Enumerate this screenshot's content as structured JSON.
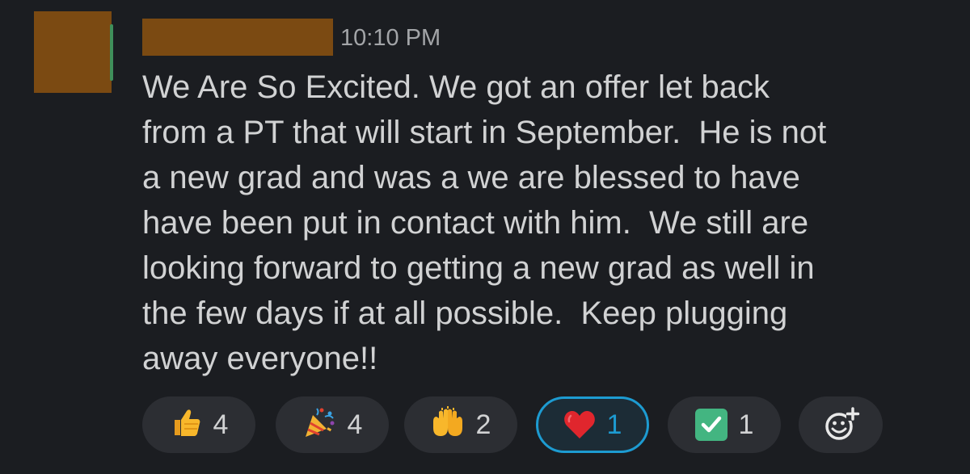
{
  "message": {
    "timestamp": "10:10 PM",
    "lines": [
      "We Are So Excited. We got an offer let back",
      "from a PT that will start in September.  He is not",
      "a new grad and was a we are blessed to have",
      "have been put in contact with him.  We still are",
      "looking forward to getting a new grad as well in",
      "the few days if at all possible.  Keep plugging",
      "away everyone!!"
    ]
  },
  "reactions": [
    {
      "icon": "thumbs-up",
      "emoji": "👍",
      "count": "4",
      "active": false
    },
    {
      "icon": "party-popper",
      "emoji": "🎉",
      "count": "4",
      "active": false
    },
    {
      "icon": "raising-hands",
      "emoji": "🙌",
      "count": "2",
      "active": false
    },
    {
      "icon": "red-heart",
      "emoji": "❤",
      "count": "1",
      "active": true
    },
    {
      "icon": "check-mark-button",
      "emoji": "✅",
      "count": "1",
      "active": false
    }
  ],
  "colors": {
    "background": "#1b1d21",
    "text": "#d1d2d3",
    "timestamp": "#a3a5a8",
    "pill": "#2c2e33",
    "active_border": "#1d9bd1",
    "redaction": "#7b4a12"
  },
  "add_reaction_icon": "add-reaction-icon"
}
